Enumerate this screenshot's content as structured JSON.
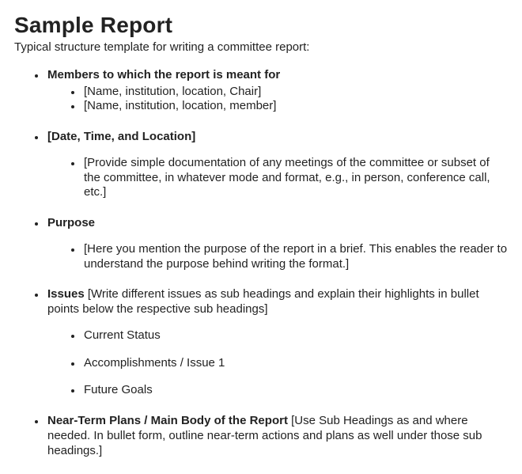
{
  "title": "Sample Report",
  "intro": "Typical structure template for writing a committee report:",
  "sections": {
    "members": {
      "heading": "Members to which the report is meant for",
      "items": [
        "[Name, institution, location, Chair]",
        "[Name, institution, location, member]"
      ]
    },
    "date": {
      "heading": "[Date, Time, and Location]",
      "items": [
        "[Provide simple documentation of any meetings of the committee or subset of the committee, in whatever mode and format, e.g., in person, conference call, etc.]"
      ]
    },
    "purpose": {
      "heading": "Purpose",
      "items": [
        "[Here you mention the purpose of the report in a brief. This enables the reader to understand the purpose behind writing the format.]"
      ]
    },
    "issues": {
      "heading": "Issues",
      "desc": " [Write different issues as sub headings and explain their highlights in bullet points below the respective sub headings]",
      "items": [
        "Current Status",
        "Accomplishments / Issue 1",
        "Future Goals"
      ]
    },
    "near_term": {
      "heading": "Near-Term Plans / Main Body of the Report",
      "desc": " [Use Sub Headings as and where needed. In bullet form, outline near-term actions and plans as well under those sub headings.]"
    }
  }
}
